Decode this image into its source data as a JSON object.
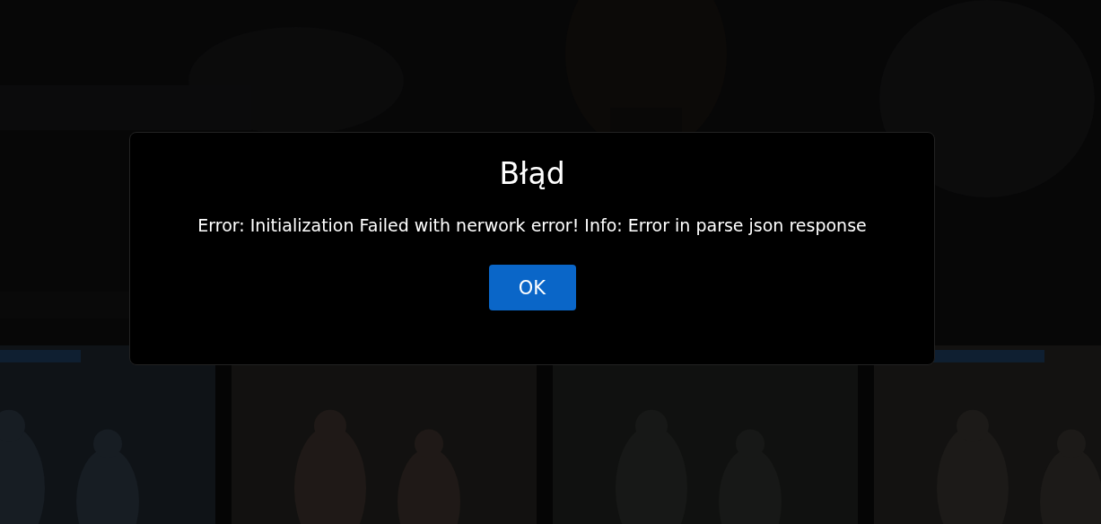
{
  "dialog": {
    "title": "Błąd",
    "message": "Error: Initialization Failed with nerwork error! Info: Error in parse json response",
    "buttons": [
      "OK"
    ]
  }
}
